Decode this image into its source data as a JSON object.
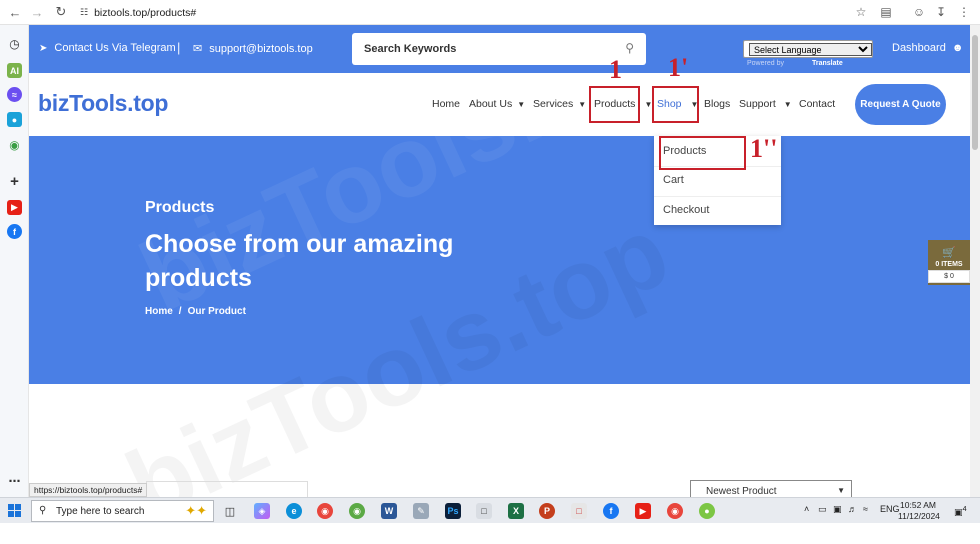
{
  "browser": {
    "url": "biztools.top/products#",
    "status_url": "https://biztools.top/products#"
  },
  "topbar": {
    "telegram": "Contact Us Via Telegram",
    "separator": "|",
    "email": "support@biztools.top",
    "search_placeholder": "Search Keywords",
    "language": "Select Language",
    "powered_by": "Powered by",
    "translate": "Translate",
    "dashboard": "Dashboard"
  },
  "header": {
    "logo": "bizTools.top",
    "nav": [
      "Home",
      "About Us",
      "Services",
      "Products",
      "Shop",
      "Blogs",
      "Support",
      "Contact"
    ],
    "quote": "Request A Quote"
  },
  "annotations": {
    "a1": "1",
    "a2": "1'",
    "a3": "1''"
  },
  "dropdown": {
    "items": [
      "Products",
      "Cart",
      "Checkout"
    ]
  },
  "hero": {
    "subtitle": "Products",
    "title": "Choose from our amazing products",
    "crumb_home": "Home",
    "crumb_sep": "/",
    "crumb_current": "Our Product"
  },
  "cart": {
    "items": "0 ITEMS",
    "total": "$ 0"
  },
  "sort": {
    "selected": "Newest Product"
  },
  "taskbar": {
    "search": "Type here to search",
    "lang": "ENG",
    "time": "10:52 AM",
    "date": "11/12/2024",
    "notifications": "4"
  },
  "watermark": "bizTools.top"
}
